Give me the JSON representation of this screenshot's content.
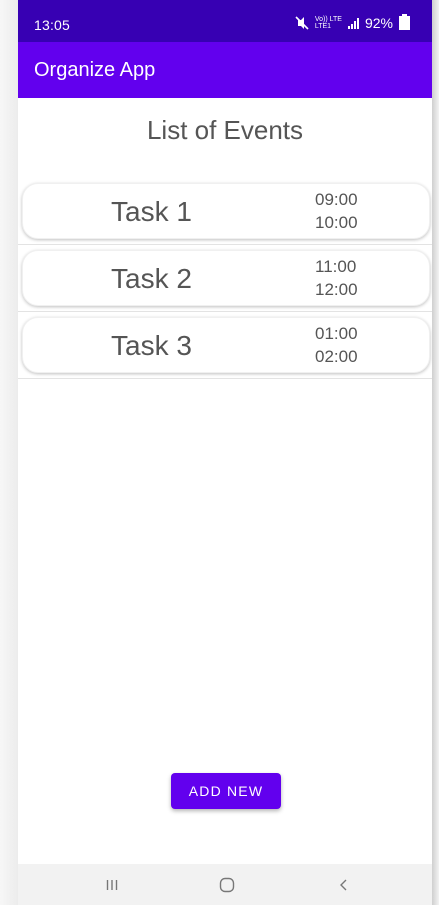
{
  "status_bar": {
    "time": "13:05",
    "network_label_top": "Vo)) LTE",
    "network_label_bottom": "LTE1",
    "battery": "92%"
  },
  "app_bar": {
    "title": "Organize App"
  },
  "main": {
    "heading": "List of Events",
    "events": [
      {
        "name": "Task 1",
        "start": "09:00",
        "end": "10:00"
      },
      {
        "name": "Task 2",
        "start": "11:00",
        "end": "12:00"
      },
      {
        "name": "Task 3",
        "start": "01:00",
        "end": "02:00"
      }
    ],
    "add_button_label": "ADD NEW"
  },
  "nav_bar": {
    "recents": "recents-icon",
    "home": "home-icon",
    "back": "back-icon"
  },
  "colors": {
    "status_bar": "#3700b3",
    "primary": "#6200ee",
    "text": "#555555"
  }
}
